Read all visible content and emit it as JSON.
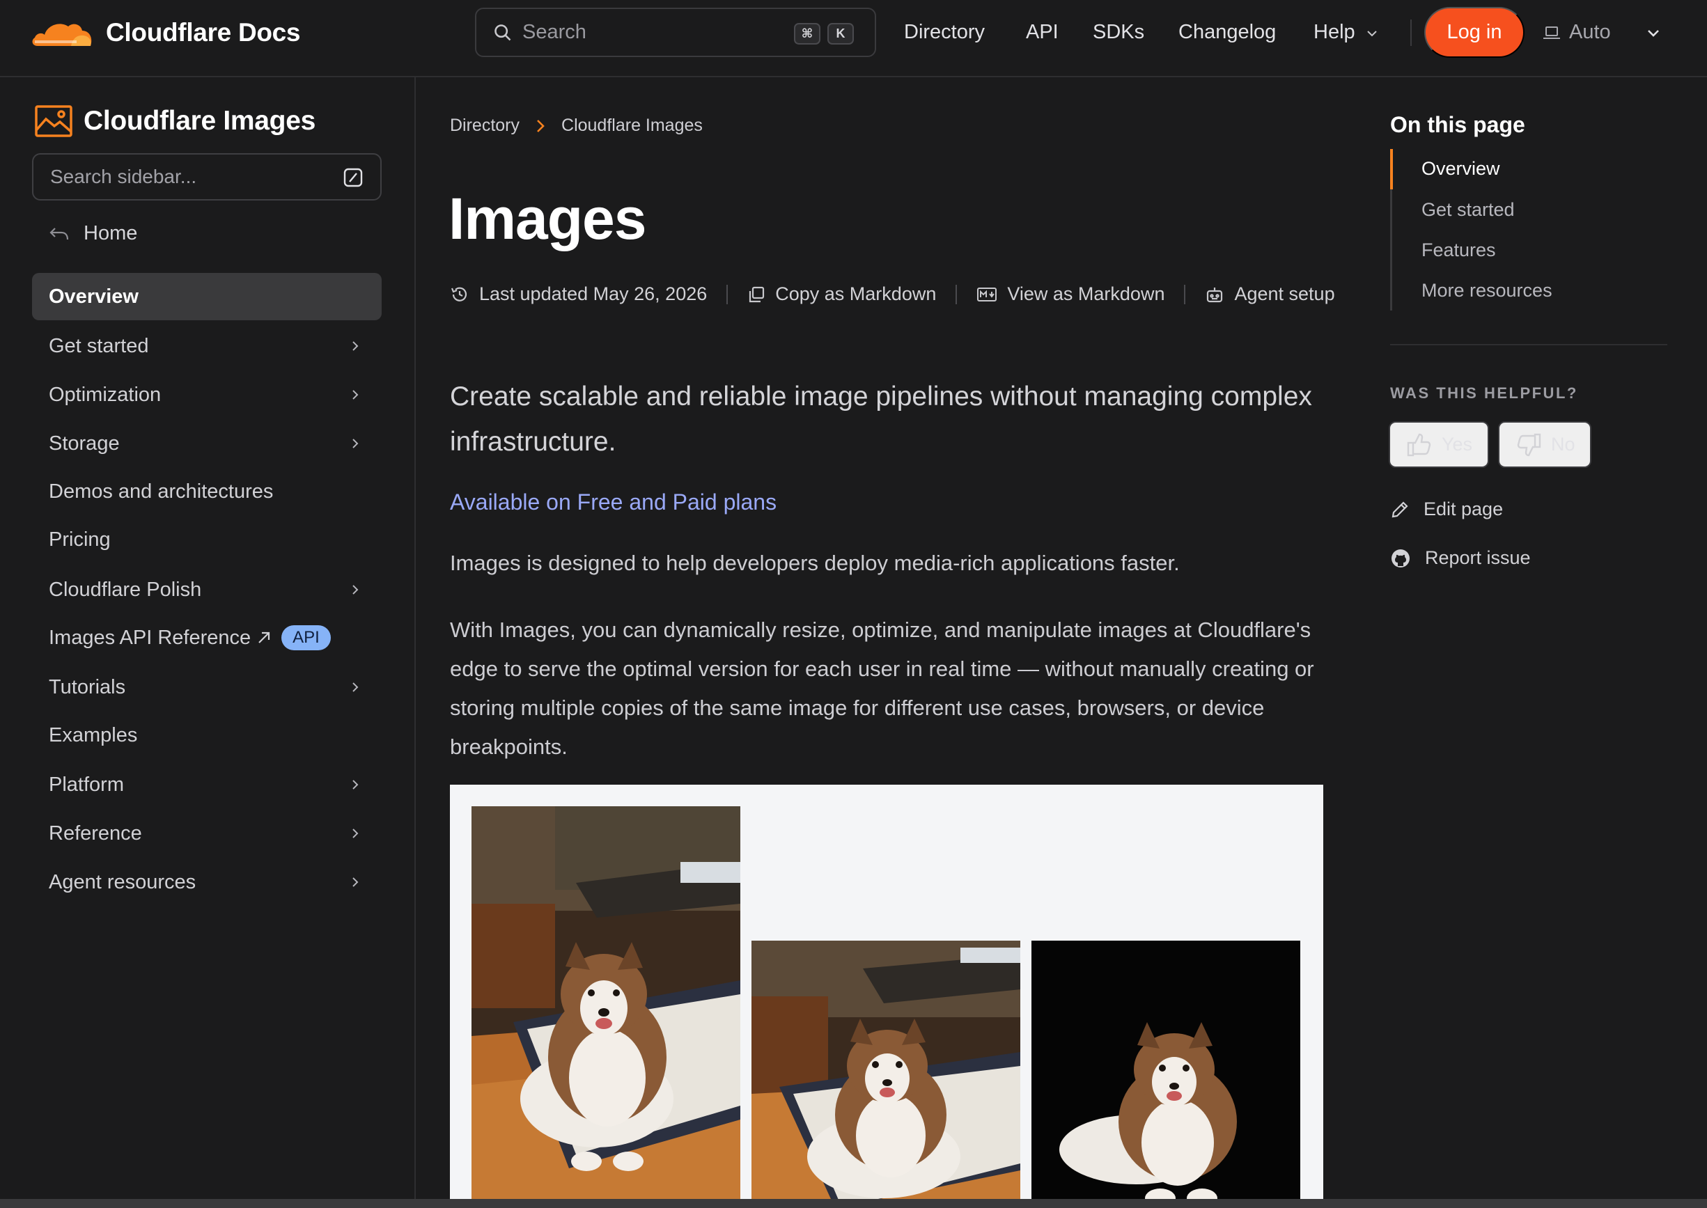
{
  "header": {
    "brand": "Cloudflare Docs",
    "search_placeholder": "Search",
    "kbd_cmd": "⌘",
    "kbd_k": "K",
    "nav": [
      "Directory",
      "API",
      "SDKs",
      "Changelog",
      "Help"
    ],
    "login": "Log in",
    "theme": "Auto"
  },
  "sidebar": {
    "title": "Cloudflare Images",
    "search_placeholder": "Search sidebar...",
    "home": "Home",
    "items": [
      {
        "label": "Overview"
      },
      {
        "label": "Get started"
      },
      {
        "label": "Optimization"
      },
      {
        "label": "Storage"
      },
      {
        "label": "Demos and architectures"
      },
      {
        "label": "Pricing"
      },
      {
        "label": "Cloudflare Polish"
      },
      {
        "label": "Images API Reference"
      },
      {
        "label": "Tutorials"
      },
      {
        "label": "Examples"
      },
      {
        "label": "Platform"
      },
      {
        "label": "Reference"
      },
      {
        "label": "Agent resources"
      }
    ],
    "api_badge": "API"
  },
  "breadcrumb": [
    "Directory",
    "Cloudflare Images"
  ],
  "main": {
    "title": "Images",
    "last_updated": "Last updated May 26, 2026",
    "copy_md": "Copy as Markdown",
    "view_md": "View as Markdown",
    "agent_setup": "Agent setup",
    "lead": "Create scalable and reliable image pipelines without managing complex infrastructure.",
    "plans": "Available on Free and Paid plans",
    "para1": "Images is designed to help developers deploy media-rich applications faster.",
    "para2": "With Images, you can dynamically resize, optimize, and manipulate images at Cloudflare's edge to serve the optimal version for each user in real time — without manually creating or storing multiple copies of the same image for different use cases, browsers, or device breakpoints."
  },
  "right_rail": {
    "title": "On this page",
    "toc": [
      "Overview",
      "Get started",
      "Features",
      "More resources"
    ],
    "helpful": "WAS THIS HELPFUL?",
    "yes": "Yes",
    "no": "No",
    "edit_page": "Edit page",
    "report_issue": "Report issue"
  },
  "colors": {
    "accent": "#f6821f",
    "login_bg": "#f6501e",
    "link": "#9aa9f7",
    "badge": "#86b3f7",
    "background": "#1b1b1c"
  }
}
